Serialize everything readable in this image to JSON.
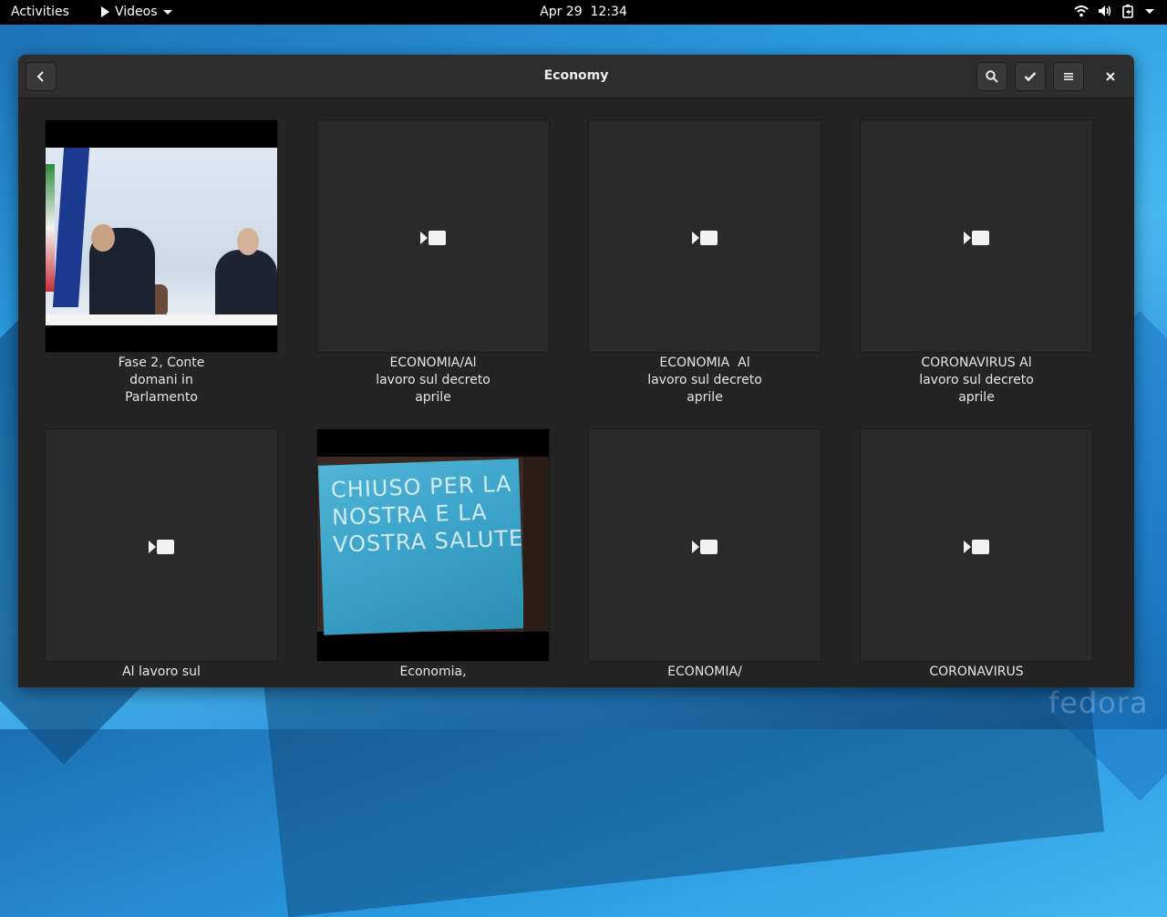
{
  "topbar": {
    "activities": "Activities",
    "app_name": "Videos",
    "clock": "Apr 29  12:34",
    "status_icons": [
      "wifi-icon",
      "volume-icon",
      "battery-icon",
      "system-menu-caret"
    ]
  },
  "window": {
    "title": "Economy",
    "buttons": [
      "back-icon",
      "search-icon",
      "select-check-icon",
      "menu-icon",
      "close-icon"
    ]
  },
  "videos": [
    {
      "caption": "Fase 2, Conte domani in Parlamento",
      "thumbnail": "photo"
    },
    {
      "caption": "ECONOMIA/Al lavoro sul decreto aprile",
      "thumbnail": "placeholder"
    },
    {
      "caption": "ECONOMIA  Al lavoro sul decreto aprile",
      "thumbnail": "placeholder"
    },
    {
      "caption": "CORONAVIRUS Al lavoro sul decreto aprile",
      "thumbnail": "placeholder"
    },
    {
      "caption": "Al lavoro sul",
      "thumbnail": "placeholder"
    },
    {
      "caption": "Economia,",
      "thumbnail": "photo"
    },
    {
      "caption": "ECONOMIA/",
      "thumbnail": "placeholder"
    },
    {
      "caption": "CORONAVIRUS",
      "thumbnail": "placeholder"
    }
  ],
  "thumbnail_photo_text": "CHIUSO PER LA NOSTRA E LA VOSTRA SALUTE",
  "desktop_watermark": "fedora",
  "colors": {
    "topbar": "#000000",
    "window_bg": "#242424",
    "headerbar": "#2d2d2d",
    "desktop_accent": "#2a9be0"
  }
}
